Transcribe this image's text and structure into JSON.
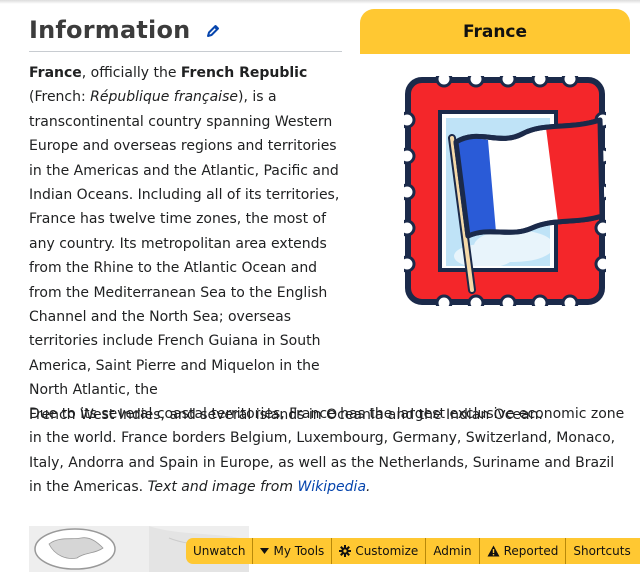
{
  "section": {
    "heading": "Information"
  },
  "infobox": {
    "title": "France",
    "image_icon": "stamp-with-french-flag-icon",
    "colors": {
      "header": "#ffc832",
      "stamp_frame": "#f4262a",
      "stamp_outline": "#1b2a4a"
    }
  },
  "paragraph1": {
    "s1": "France",
    "s2": ", officially the ",
    "s3": "French Republic",
    "s4": " (French: ",
    "s5": "République française",
    "s6": "), is a transcontinental country spanning Western Europe and overseas regions and territories in the Americas and the Atlantic, Pacific and Indian Oceans. Including all of its territories, France has twelve time zones, the most of any country. Its metropolitan area extends from the Rhine to the Atlantic Ocean and from the Mediterranean Sea to the English Channel and the North Sea; overseas territories include French Guiana in South America, Saint Pierre and Miquelon in the North Atlantic, the",
    "s7": "French West Indies, and several islands in Oceania and the Indian Ocean."
  },
  "paragraph2": {
    "s1": "Due to its several coastal territories, France has the largest exclusive economic zone in the world. France borders Belgium, Luxembourg, Germany, Switzerland, Monaco, Italy, Andorra and Spain in Europe, as well as the Netherlands, Suriname and Brazil in the Americas. ",
    "s2": "Text and image from ",
    "link": "Wikipedia",
    "s3": "."
  },
  "toolbar": {
    "unwatch": "Unwatch",
    "my_tools": "My Tools",
    "customize": "Customize",
    "admin": "Admin",
    "reported": "Reported",
    "shortcuts": "Shortcuts"
  }
}
